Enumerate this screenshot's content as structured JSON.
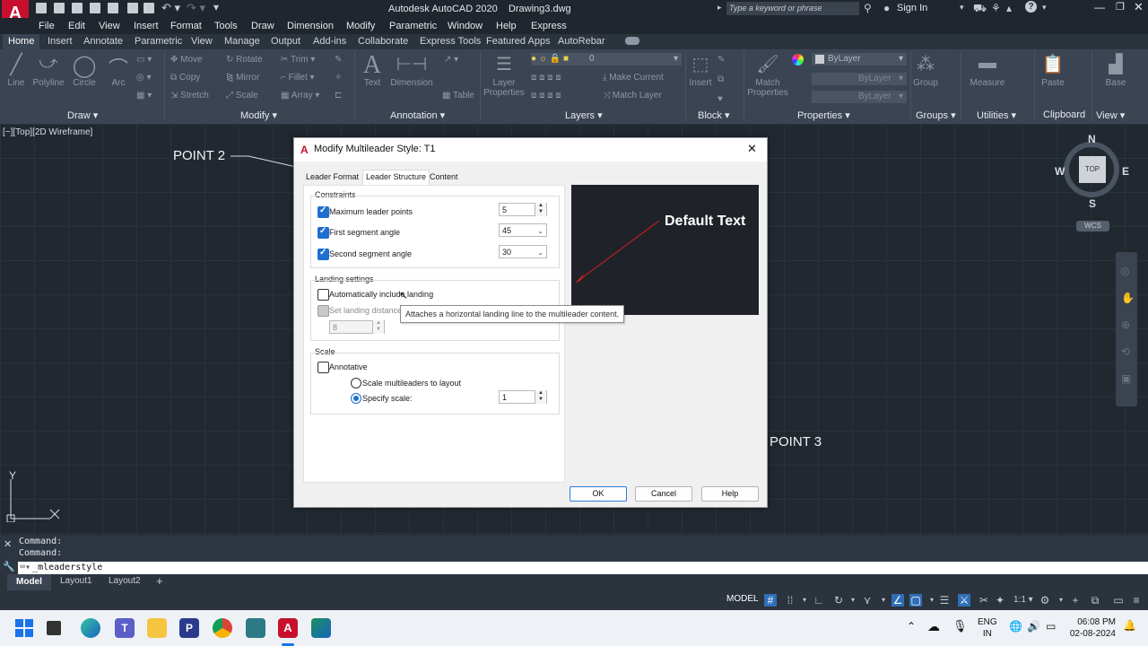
{
  "app": {
    "title": "Autodesk AutoCAD 2020",
    "filename": "Drawing3.dwg",
    "search_placeholder": "Type a keyword or phrase",
    "sign_in": "Sign In"
  },
  "menubar": [
    "File",
    "Edit",
    "View",
    "Insert",
    "Format",
    "Tools",
    "Draw",
    "Dimension",
    "Modify",
    "Parametric",
    "Window",
    "Help",
    "Express"
  ],
  "ribbon_tabs": [
    "Home",
    "Insert",
    "Annotate",
    "Parametric",
    "View",
    "Manage",
    "Output",
    "Add-ins",
    "Collaborate",
    "Express Tools",
    "Featured Apps",
    "AutoRebar"
  ],
  "ribbon": {
    "draw": {
      "line": "Line",
      "polyline": "Polyline",
      "circle": "Circle",
      "arc": "Arc",
      "label": "Draw"
    },
    "modify": {
      "move": "Move",
      "rotate": "Rotate",
      "trim": "Trim",
      "copy": "Copy",
      "mirror": "Mirror",
      "fillet": "Fillet",
      "stretch": "Stretch",
      "scale": "Scale",
      "array": "Array",
      "label": "Modify"
    },
    "annotation": {
      "text": "Text",
      "dimension": "Dimension",
      "table": "Table",
      "label": "Annotation"
    },
    "layers": {
      "layer_properties": "Layer Properties",
      "layer_value": "0",
      "make_current": "Make Current",
      "match_layer": "Match Layer",
      "label": "Layers"
    },
    "block": {
      "insert": "Insert",
      "label": "Block"
    },
    "properties": {
      "match_properties": "Match Properties",
      "bylayer1": "ByLayer",
      "bylayer2": "ByLayer",
      "bylayer3": "ByLayer",
      "label": "Properties"
    },
    "groups": {
      "group": "Group",
      "label": "Groups"
    },
    "utilities": {
      "measure": "Measure",
      "label": "Utilities"
    },
    "clipboard": {
      "paste": "Paste",
      "label": "Clipboard"
    },
    "view": {
      "base": "Base",
      "label": "View"
    }
  },
  "viewport": {
    "label": "[−][Top][2D Wireframe]",
    "point2": "POINT 2",
    "point3": "POINT 3",
    "viewcube": {
      "n": "N",
      "s": "S",
      "e": "E",
      "w": "W",
      "top": "TOP",
      "wcs": "WCS"
    },
    "ucs": {
      "y": "Y"
    }
  },
  "dialog": {
    "title": "Modify Multileader Style: T1",
    "tabs": [
      "Leader Format",
      "Leader Structure",
      "Content"
    ],
    "active_tab": "Leader Structure",
    "constraints": {
      "heading": "Constraints",
      "max_points_label": "Maximum leader points",
      "max_points_value": "5",
      "max_points_checked": true,
      "first_angle_label": "First segment angle",
      "first_angle_value": "45",
      "first_angle_checked": true,
      "second_angle_label": "Second segment angle",
      "second_angle_value": "30",
      "second_angle_checked": true
    },
    "landing": {
      "heading": "Landing settings",
      "auto_include_label": "Automatically include landing",
      "auto_include_checked": false,
      "set_distance_label": "Set landing distance",
      "set_distance_checked": true,
      "distance_value": "8"
    },
    "tooltip": "Attaches a horizontal landing line to the multileader content.",
    "scale": {
      "heading": "Scale",
      "annotative_label": "Annotative",
      "annotative_checked": false,
      "scale_to_layout_label": "Scale multileaders to layout",
      "specify_scale_label": "Specify scale:",
      "specify_scale_value": "1",
      "selected": "specify"
    },
    "preview_text": "Default Text",
    "buttons": {
      "ok": "OK",
      "cancel": "Cancel",
      "help": "Help"
    }
  },
  "command": {
    "line1": "Command:",
    "line2": "Command:",
    "input": "_mleaderstyle"
  },
  "layout_tabs": [
    "Model",
    "Layout1",
    "Layout2"
  ],
  "status": {
    "model": "MODEL",
    "scale": "1:1"
  },
  "taskbar": {
    "lang1": "ENG",
    "lang2": "IN",
    "time": "06:08 PM",
    "date": "02-08-2024"
  },
  "colors": {
    "accent": "#1e6fd0",
    "canvas": "#212830",
    "ribbon": "#3b4452",
    "preview_bg": "#1f2329",
    "leader_red": "#d42020"
  }
}
